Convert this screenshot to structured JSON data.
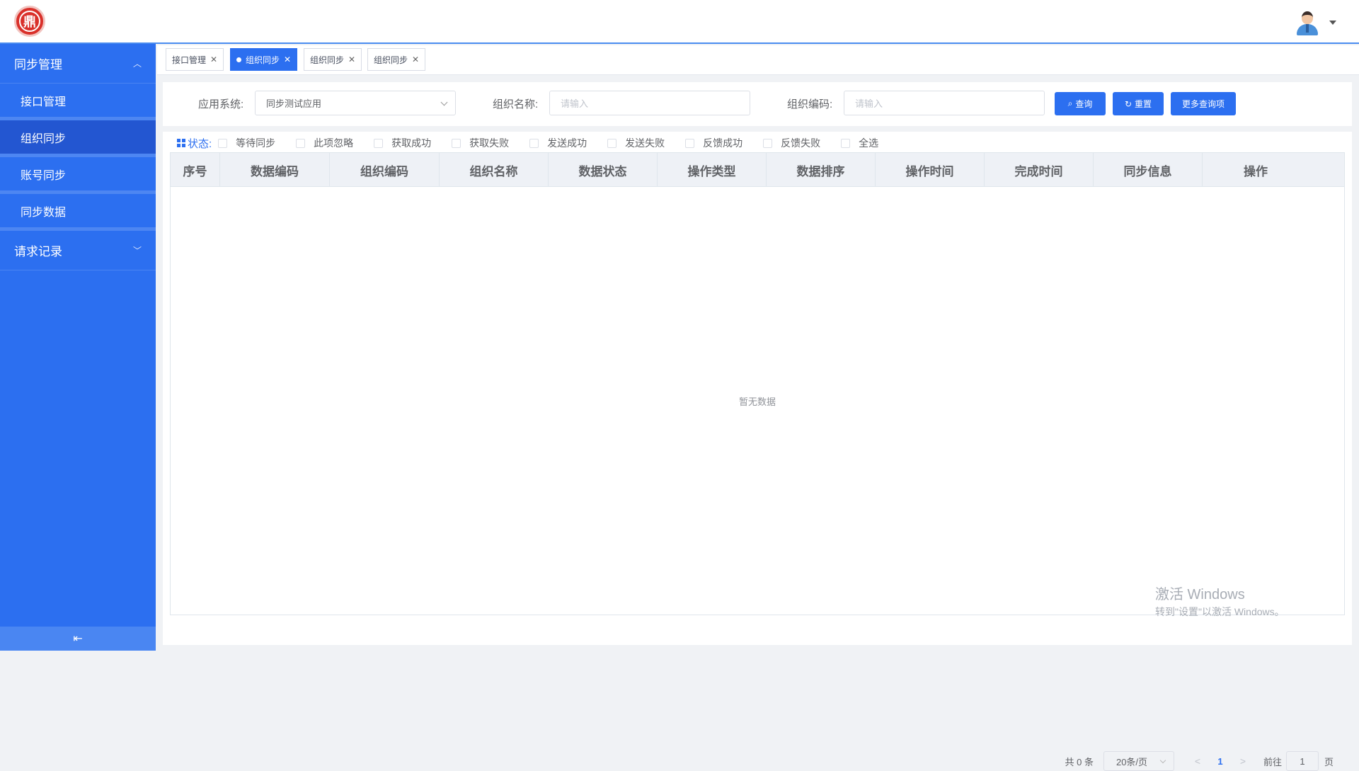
{
  "header": {
    "logo_glyph": "鼎",
    "user_menu_icon": "avatar-icon"
  },
  "sidebar": {
    "groups": [
      {
        "label": "同步管理",
        "arrow": "^",
        "expanded": true
      },
      {
        "label": "请求记录",
        "arrow": "v",
        "expanded": false
      }
    ],
    "items": [
      {
        "label": "接口管理",
        "active": false
      },
      {
        "label": "组织同步",
        "active": true
      },
      {
        "label": "账号同步",
        "active": false
      },
      {
        "label": "同步数据",
        "active": false
      }
    ],
    "collapse_glyph": "⇤"
  },
  "tabs": [
    {
      "label": "接口管理",
      "active": false
    },
    {
      "label": "组织同步",
      "active": true
    },
    {
      "label": "组织同步",
      "active": false
    },
    {
      "label": "组织同步",
      "active": false
    }
  ],
  "filters": {
    "app_system_label": "应用系统:",
    "app_system_value": "同步测试应用",
    "org_name_label": "组织名称:",
    "org_name_placeholder": "请输入",
    "org_code_label": "组织编码:",
    "org_code_placeholder": "请输入",
    "query_button": "查询",
    "reset_button": "重置",
    "more_button": "更多查询项"
  },
  "status": {
    "title": "状态:",
    "options": [
      "等待同步",
      "此项忽略",
      "获取成功",
      "获取失败",
      "发送成功",
      "发送失败",
      "反馈成功",
      "反馈失败",
      "全选"
    ]
  },
  "table": {
    "columns": [
      "序号",
      "数据编码",
      "组织编码",
      "组织名称",
      "数据状态",
      "操作类型",
      "数据排序",
      "操作时间",
      "完成时间",
      "同步信息",
      "操作"
    ],
    "empty_text": "暂无数据"
  },
  "watermark": {
    "line1": "激活 Windows",
    "line2": "转到\"设置\"以激活 Windows。"
  },
  "pager": {
    "total": "共 0 条",
    "page_size": "20条/页",
    "prev": "<",
    "current_page": "1",
    "next": ">",
    "goto_label": "前往",
    "goto_value": "1",
    "page_suffix": "页"
  },
  "colors": {
    "primary": "#2c6ff0",
    "sidebar_active": "#2356d1"
  }
}
